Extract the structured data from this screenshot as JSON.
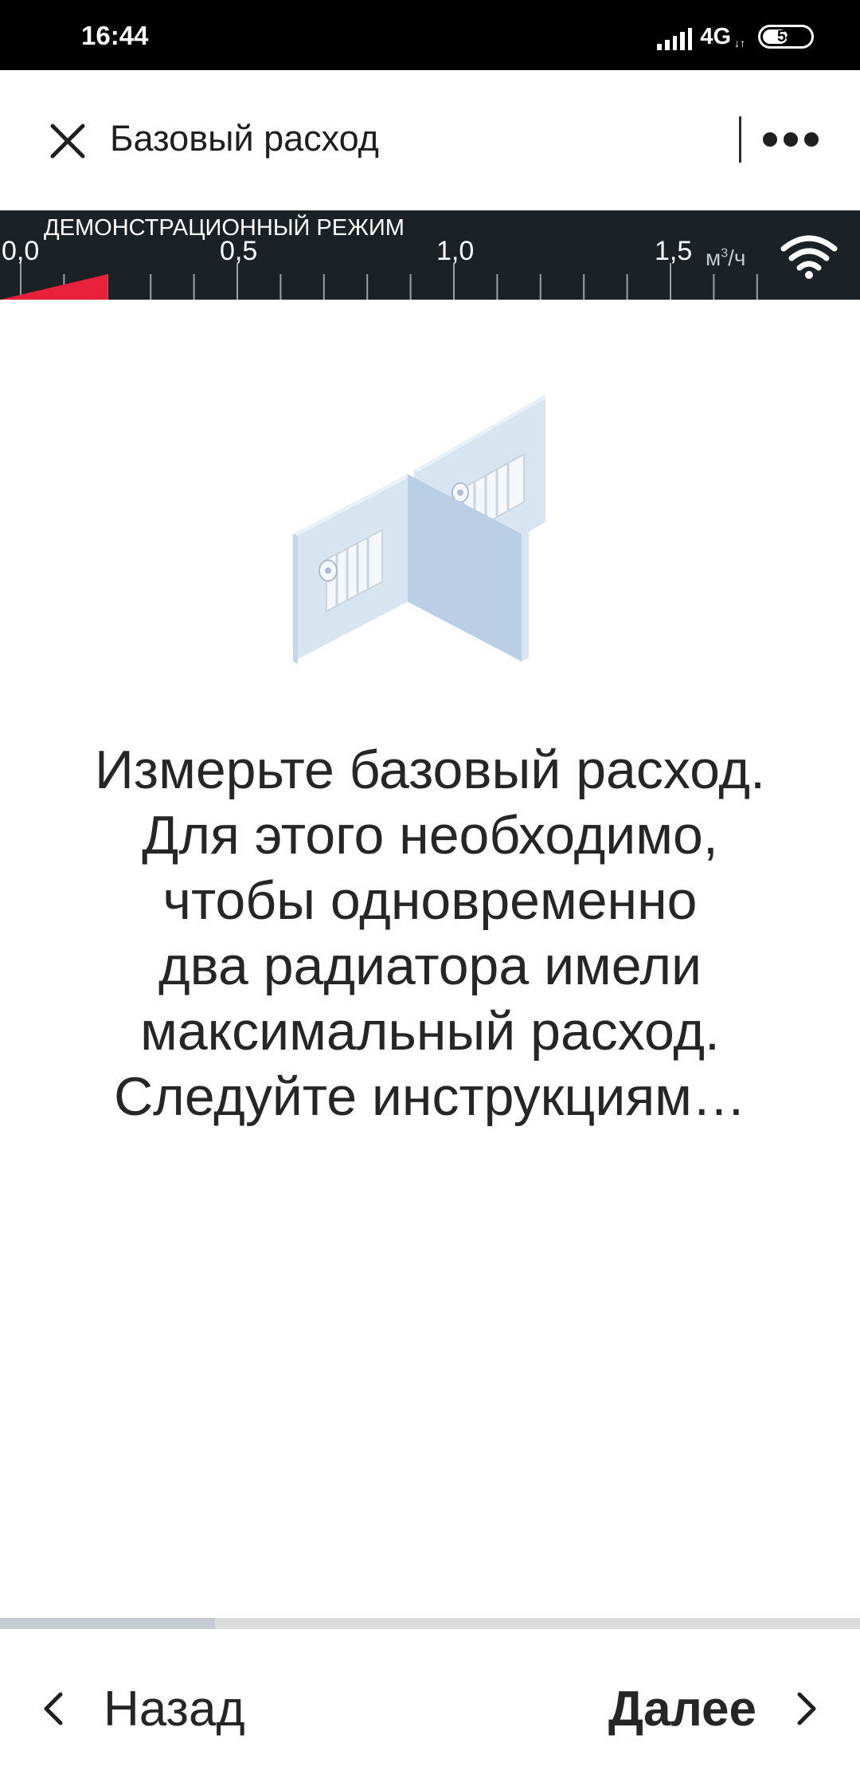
{
  "status_bar": {
    "time": "16:44",
    "network": "4G",
    "battery": "54",
    "battery_level": 0.54
  },
  "header": {
    "title": "Базовый расход"
  },
  "gauge": {
    "mode_label": "ДЕМОНСТРАЦИОННЫЙ РЕЖИМ",
    "ticks": [
      "0,0",
      "0,5",
      "1,0",
      "1,5"
    ],
    "unit_base": "м",
    "unit_exp": "3",
    "unit_tail": "/ч",
    "current_value": 0.12,
    "max_value": 1.5,
    "indicator_color": "#e8203a"
  },
  "content": {
    "illustration": "two-radiators-walls",
    "message": "Измерьте базовый расход.\nДля этого необходимо,\nчтобы одновременно\nдва радиатора имели\nмаксимальный расход.\nСледуйте инструкциям…"
  },
  "progress": {
    "fraction": 0.25
  },
  "nav": {
    "back_label": "Назад",
    "next_label": "Далее"
  },
  "colors": {
    "gauge_background": "#1c2126",
    "accent_red": "#e8203a",
    "wall_light": "#d8e4f0",
    "wall_mid": "#b9cfe5"
  }
}
